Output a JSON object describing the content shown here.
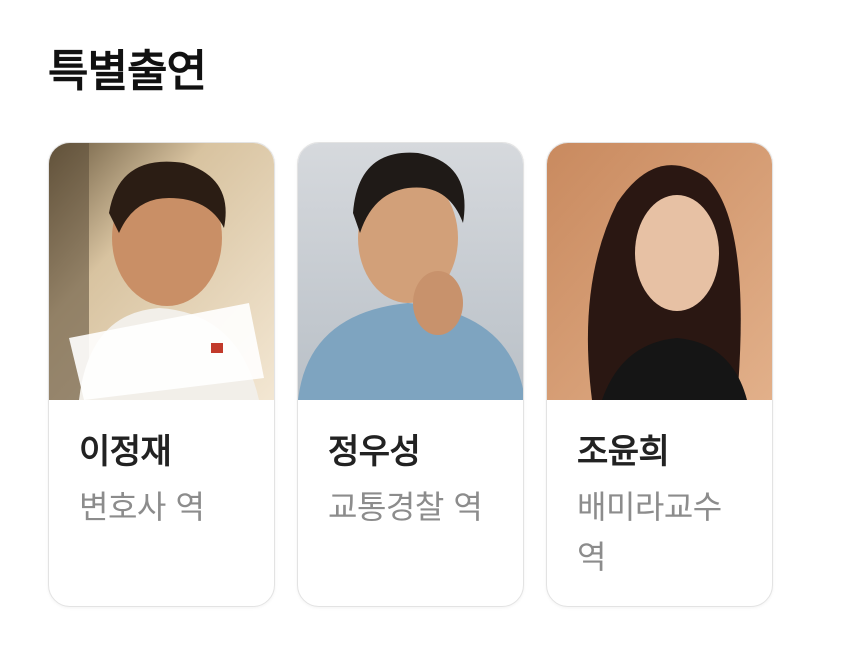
{
  "section": {
    "title": "특별출연"
  },
  "cast": [
    {
      "name": "이정재",
      "role": "변호사 역",
      "photo_icon": "actor-photo"
    },
    {
      "name": "정우성",
      "role": "교통경찰 역",
      "photo_icon": "actor-photo"
    },
    {
      "name": "조윤희",
      "role": "배미라교수 역",
      "photo_icon": "actor-photo"
    }
  ]
}
